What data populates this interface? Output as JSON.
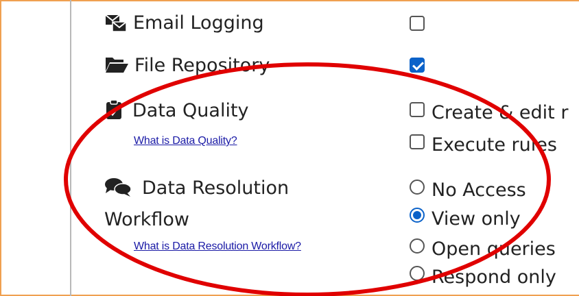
{
  "rows": {
    "email_logging": {
      "label": "Email Logging",
      "icon": "email-envelope-icon",
      "checked": false
    },
    "file_repository": {
      "label": "File Repository",
      "icon": "folder-open-icon",
      "checked": true
    },
    "data_quality": {
      "label": "Data Quality",
      "icon": "clipboard-check-icon",
      "help_link": "What is Data Quality?",
      "options": [
        {
          "label": "Create & edit r",
          "checked": false
        },
        {
          "label": "Execute rules",
          "checked": false
        }
      ]
    },
    "data_resolution": {
      "label_line1": "Data Resolution",
      "label_line2": "Workflow",
      "icon": "comments-icon",
      "help_link": "What is Data Resolution Workflow?",
      "options": [
        {
          "label": "No Access",
          "selected": false
        },
        {
          "label": "View only",
          "selected": true
        },
        {
          "label": "Open queries",
          "selected": false
        },
        {
          "label": "Respond only",
          "selected": false
        }
      ]
    }
  },
  "colors": {
    "frame_border": "#f0a050",
    "accent": "#0b62c9",
    "link": "#1a1aa6",
    "annotation": "#e00000"
  }
}
